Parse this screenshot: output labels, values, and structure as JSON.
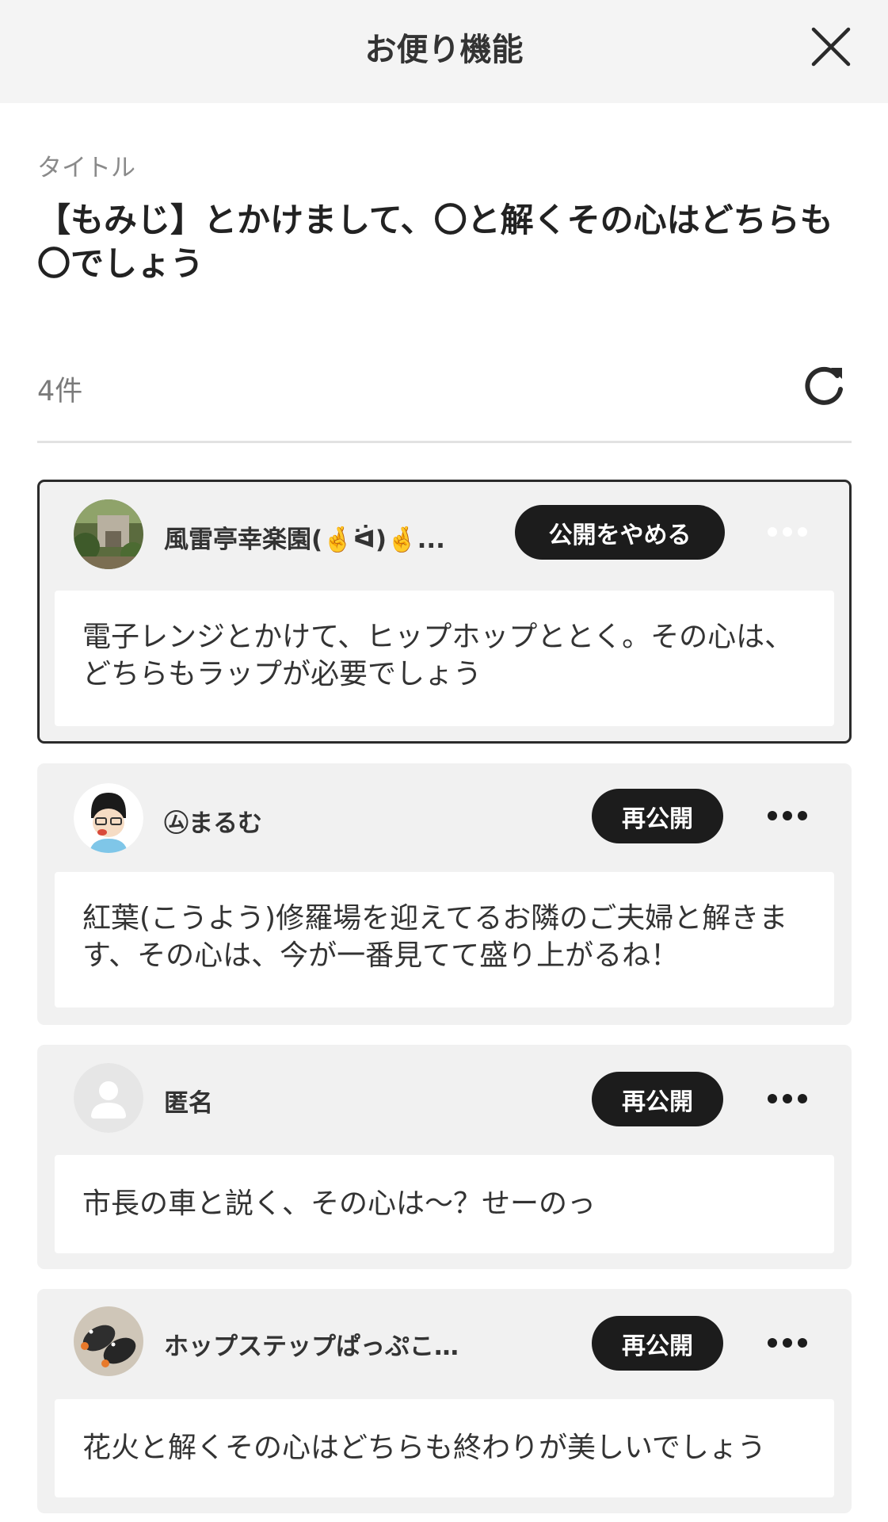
{
  "header": {
    "title": "お便り機能"
  },
  "topic": {
    "label": "タイトル",
    "title": "【もみじ】とかけまして、〇と解くその心はどちらも〇でしょう"
  },
  "list": {
    "count": "4件"
  },
  "letters": [
    {
      "author": "風雷亭幸楽園(🤞ᐛ)🤞...",
      "action": "公開をやめる",
      "body": "電子レンジとかけて、ヒップホップととく。その心は、どちらもラップが必要でしょう",
      "avatar": "photo-avatar-garden"
    },
    {
      "author": "㋰まるむ",
      "action": "再公開",
      "body": "紅葉(こうよう)修羅場を迎えてるお隣のご夫婦と解きます、その心は、今が一番見てて盛り上がるね！",
      "avatar": "illustration-avatar"
    },
    {
      "author": "匿名",
      "action": "再公開",
      "body": "市長の車と説く、その心は～？せーのっ",
      "avatar": "anonymous-avatar"
    },
    {
      "author": "ホップステップぱっぷこーぉん…",
      "action": "再公開",
      "body": "花火と解くその心はどちらも終わりが美しいでしょう",
      "avatar": "photo-avatar-birds"
    }
  ],
  "colors": {
    "header_bg": "#f4f4f4",
    "card_bg": "#f1f1f1",
    "pill_bg": "#1c1c1c",
    "selected_border": "#2b2b2b"
  }
}
